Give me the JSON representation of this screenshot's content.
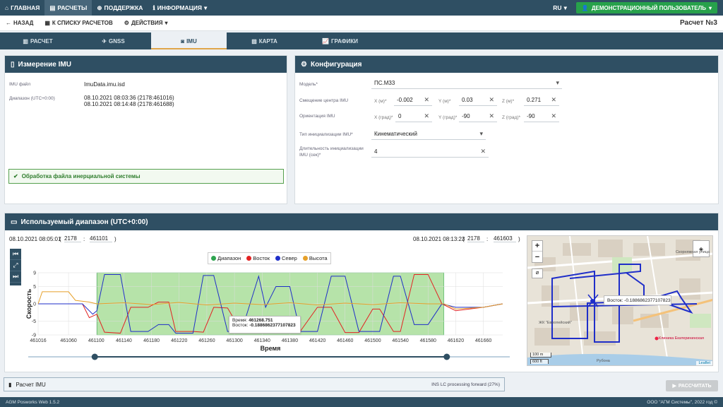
{
  "nav": {
    "home": "ГЛАВНАЯ",
    "calcs": "РАСЧЕТЫ",
    "support": "ПОДДЕРЖКА",
    "info": "ИНФОРМАЦИЯ",
    "lang": "RU",
    "user": "ДЕМОНСТРАЦИОННЫЙ ПОЛЬЗОВАТЕЛЬ"
  },
  "subbar": {
    "back": "НАЗАД",
    "list": "К СПИСКУ РАСЧЕТОВ",
    "actions": "ДЕЙСТВИЯ",
    "title": "Расчет №3"
  },
  "tabs": [
    "РАСЧЕТ",
    "GNSS",
    "IMU",
    "КАРТА",
    "ГРАФИКИ"
  ],
  "imu_panel": {
    "title": "Измерение IMU",
    "file_label": "IMU файл",
    "file_value": "ImuData.imu.isd",
    "range_label": "Диапазон (UTC+0:00)",
    "range_start": "08.10.2021 08:03:36 (2178:461016)",
    "range_end": "08.10.2021 08:14:48 (2178:461688)",
    "success": "Обработка файла инерциальной системы"
  },
  "config": {
    "title": "Конфигурация",
    "model_label": "Модель*",
    "model_value": "ПС.М33",
    "offset_label": "Смещение центра IMU",
    "offset": {
      "x_label": "X (м)*",
      "x": "-0.002",
      "y_label": "Y (м)*",
      "y": "0.03",
      "z_label": "Z (м)*",
      "z": "0.271"
    },
    "orient_label": "Ориентация IMU",
    "orient": {
      "x_label": "X (град)*",
      "x": "0",
      "y_label": "Y (град)*",
      "y": "-90",
      "z_label": "Z (град)*",
      "z": "-90"
    },
    "init_type_label": "Тип инициализации IMU*",
    "init_type_value": "Кинематический",
    "init_dur_label_1": "Длительность инициализации",
    "init_dur_label_2": "IMU (сек)*",
    "init_dur_value": "4"
  },
  "range_panel": {
    "title": "Используемый диапазон (UTC+0:00)",
    "start_date": "08.10.2021 08:05:01",
    "start_week": "2178",
    "start_sec": "461101",
    "end_date": "08.10.2021 08:13:23",
    "end_week": "2178",
    "end_sec": "461603",
    "paren_open": "(",
    "paren_close": ")",
    "colon": ":"
  },
  "chart_data": {
    "type": "line",
    "xlabel": "Время",
    "ylabel": "Скорость",
    "xlim": [
      461016,
      461688
    ],
    "ylim": [
      -9,
      9
    ],
    "x_ticks": [
      461016,
      461060,
      461100,
      461140,
      461180,
      461220,
      461260,
      461300,
      461340,
      461380,
      461420,
      461460,
      461500,
      461540,
      461580,
      461620,
      461660
    ],
    "y_ticks": [
      9,
      5,
      0,
      -5,
      -9
    ],
    "grid": true,
    "legend_position": "top-center",
    "selected_range": [
      461101,
      461603
    ],
    "series": [
      {
        "name": "Диапазон",
        "color": "#2ea44f",
        "kind": "band"
      },
      {
        "name": "Восток",
        "color": "#e32222",
        "x": [
          461016,
          461080,
          461090,
          461101,
          461112,
          461135,
          461150,
          461175,
          461190,
          461205,
          461215,
          461240,
          461255,
          461270,
          461290,
          461310,
          461335,
          461345,
          461360,
          461380,
          461395,
          461420,
          461440,
          461460,
          461480,
          461500,
          461510,
          461530,
          461540,
          461560,
          461580,
          461600,
          461620,
          461660,
          461688
        ],
        "y": [
          0,
          0,
          -4,
          -3,
          -8.2,
          -8.5,
          -1,
          -1,
          0.5,
          0.5,
          -8,
          -8,
          -8.2,
          -1,
          -1.2,
          -8,
          -8,
          -8.3,
          -6,
          -8,
          -8,
          -1,
          -1,
          -8.3,
          -8.3,
          -1.5,
          -1.5,
          -8,
          -8,
          8.5,
          8.5,
          0,
          -2,
          -1,
          0
        ]
      },
      {
        "name": "Север",
        "color": "#1f2ec9",
        "x": [
          461016,
          461080,
          461095,
          461101,
          461112,
          461135,
          461150,
          461175,
          461190,
          461205,
          461215,
          461240,
          461255,
          461270,
          461290,
          461310,
          461335,
          461345,
          461360,
          461380,
          461395,
          461420,
          461440,
          461460,
          461480,
          461500,
          461510,
          461530,
          461540,
          461560,
          461580,
          461600,
          461620,
          461660,
          461688
        ],
        "y": [
          0,
          0,
          -3,
          -2,
          8.5,
          8.5,
          -8,
          -8,
          -6,
          -6,
          -8.5,
          -8.5,
          8.2,
          8.2,
          -8,
          -8,
          8,
          -1,
          5,
          5,
          -8,
          -8,
          8,
          8,
          -8,
          -8,
          -8,
          8,
          8,
          -6,
          -6,
          0,
          -1,
          -1,
          0
        ]
      },
      {
        "name": "Высота",
        "color": "#e6a02a",
        "x": [
          461016,
          461022,
          461060,
          461070,
          461090,
          461101,
          461140,
          461180,
          461220,
          461260,
          461300,
          461340,
          461380,
          461420,
          461460,
          461500,
          461540,
          461580,
          461603,
          461620,
          461660,
          461688
        ],
        "y": [
          0,
          3.5,
          3.5,
          1,
          0.5,
          0,
          0.3,
          -0.2,
          0.4,
          -0.3,
          0.2,
          -0.2,
          0.3,
          -0.3,
          0.2,
          -0.2,
          0.3,
          0,
          0,
          -1.5,
          -1,
          0
        ]
      }
    ]
  },
  "tooltip": {
    "time_label": "Время:",
    "time_value": "461268.751",
    "east_label": "Восток:",
    "east_value": "-0.1886862377107823"
  },
  "map": {
    "tooltip": "Восток: -0.1886862377107823",
    "scale_m": "100 m",
    "scale_ft": "600 ft",
    "attribution": "Leaflet",
    "street_labels": [
      "Скорняжная улица",
      "ЖК \"Европейский\"",
      "Клиника Екатерининская",
      "Рубона"
    ]
  },
  "imu_calc": {
    "title": "Расчет IMU",
    "status": "INS LC processing forward (27%)"
  },
  "run_button": "РАССЧИТАТЬ",
  "footer": {
    "version": "AGM Posworks Web 1.5.2",
    "copyright": "ООО \"АГМ Системы\", 2022 год ©"
  },
  "colors": {
    "navy": "#2f4f63",
    "green": "#27a14b",
    "accent": "#e0a64a"
  }
}
